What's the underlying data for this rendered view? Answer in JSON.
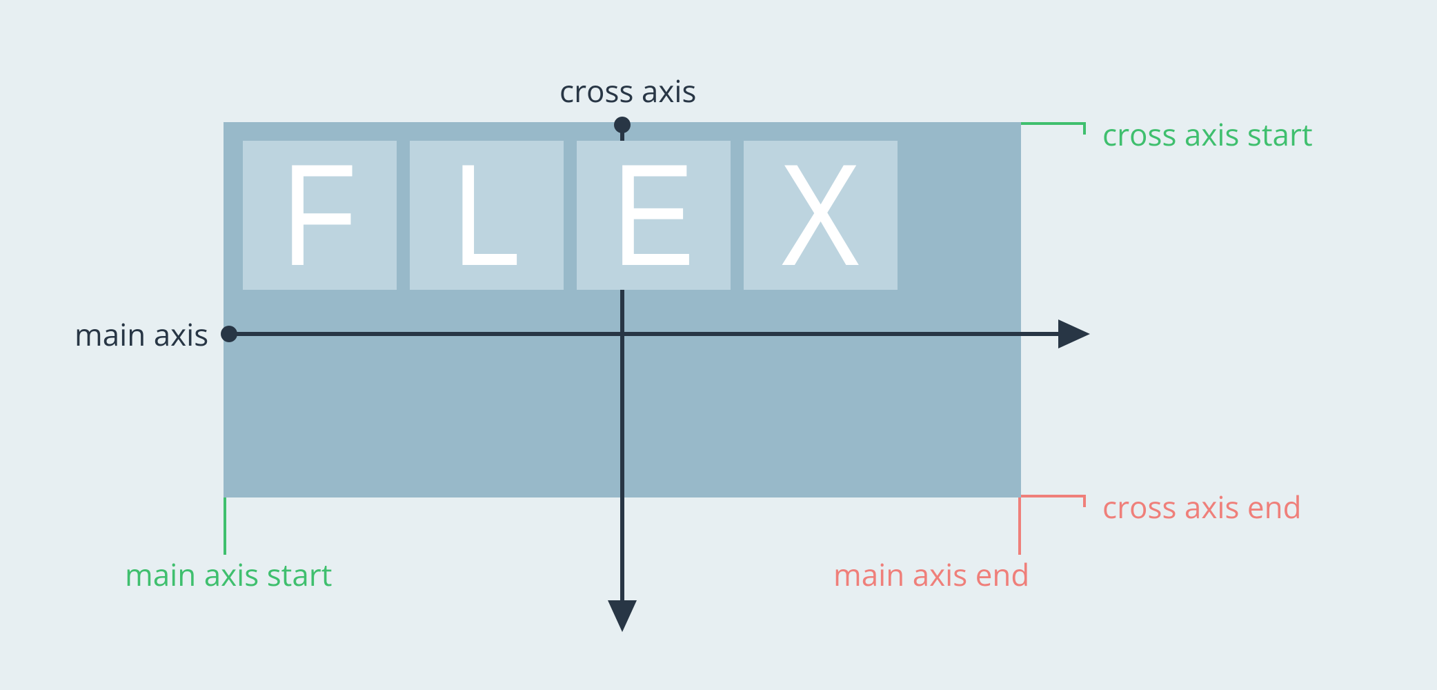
{
  "labels": {
    "cross_axis": "cross axis",
    "main_axis": "main axis",
    "cross_axis_start": "cross axis start",
    "cross_axis_end": "cross axis end",
    "main_axis_start": "main axis start",
    "main_axis_end": "main axis end"
  },
  "items": [
    "F",
    "L",
    "E",
    "X"
  ],
  "colors": {
    "bg": "#e7eff2",
    "container": "#98b9c9",
    "item": "#bdd4df",
    "letter": "#ffffff",
    "arrow": "#283645",
    "start": "#3fbf6e",
    "end": "#ef7f7a"
  }
}
